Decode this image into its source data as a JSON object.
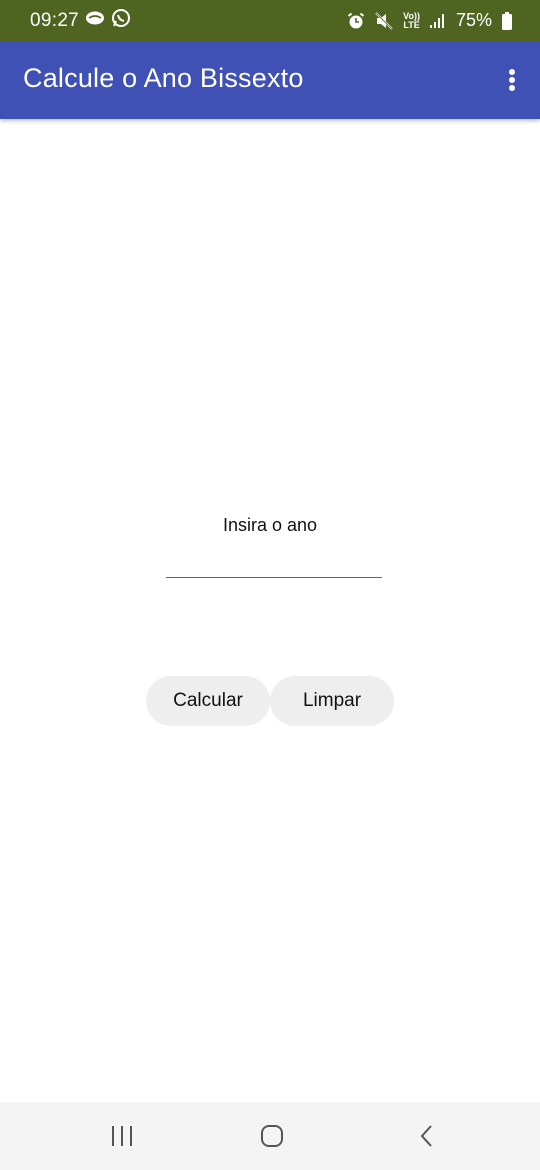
{
  "status_bar": {
    "time": "09:27",
    "battery": "75%",
    "lte_top": "Vo))",
    "lte_bottom": "LTE",
    "icons": [
      "chat-bubble-icon",
      "whatsapp-icon",
      "alarm-icon",
      "mute-icon",
      "volte-icon",
      "signal-icon",
      "battery-icon"
    ],
    "background": "#4f6420"
  },
  "app_bar": {
    "title": "Calcule o Ano Bissexto",
    "menu_icon": "more-vert-icon",
    "background": "#3f51b5"
  },
  "form": {
    "prompt": "Insira o ano",
    "year_value": "",
    "year_placeholder": ""
  },
  "buttons": {
    "calculate": "Calcular",
    "clear": "Limpar"
  },
  "nav_bar": {
    "icons": [
      "recents-icon",
      "home-icon",
      "back-icon"
    ]
  }
}
